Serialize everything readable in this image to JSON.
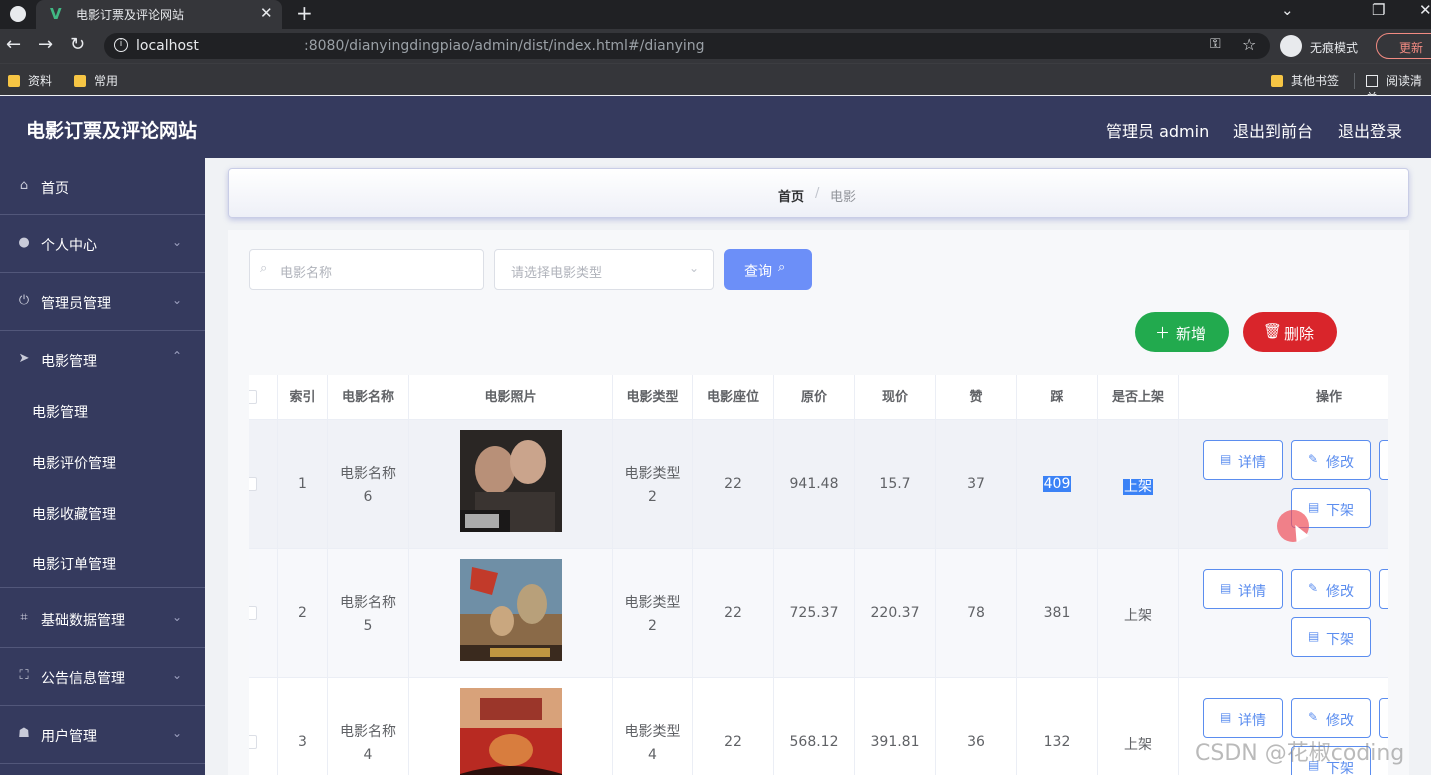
{
  "browser": {
    "tab_title": "电影订票及评论网站",
    "url_host": "localhost",
    "url_path": ":8080/dianyingdingpiao/admin/dist/index.html#/dianying",
    "incognito_label": "无痕模式",
    "update_label": "更新",
    "bookmarks": [
      "资料",
      "常用"
    ],
    "other_bookmarks": "其他书签",
    "reading_list": "阅读清单"
  },
  "header": {
    "title": "电影订票及评论网站",
    "admin_label": "管理员 admin",
    "front_label": "退出到前台",
    "logout_label": "退出登录"
  },
  "sidebar": {
    "items": [
      {
        "label": "首页",
        "icon": "home-icon"
      },
      {
        "label": "个人中心",
        "icon": "user-icon"
      },
      {
        "label": "管理员管理",
        "icon": "power-icon"
      },
      {
        "label": "电影管理",
        "icon": "send-icon"
      },
      {
        "label": "基础数据管理",
        "icon": "crop-icon"
      },
      {
        "label": "公告信息管理",
        "icon": "fullscreen-icon"
      },
      {
        "label": "用户管理",
        "icon": "thumb-icon"
      }
    ],
    "subitems": [
      "电影管理",
      "电影评价管理",
      "电影收藏管理",
      "电影订单管理"
    ]
  },
  "breadcrumb": {
    "home": "首页",
    "separator": "/",
    "current": "电影"
  },
  "search": {
    "name_placeholder": "电影名称",
    "type_placeholder": "请选择电影类型",
    "query_label": "查询",
    "add_label": "新增",
    "delete_label": "删除"
  },
  "table": {
    "columns": [
      "索引",
      "电影名称",
      "电影照片",
      "电影类型",
      "电影座位",
      "原价",
      "现价",
      "赞",
      "踩",
      "是否上架",
      "操作"
    ],
    "rows": [
      {
        "index": "1",
        "name_line1": "电影名称",
        "name_line2": "6",
        "type_line1": "电影类型",
        "type_line2": "2",
        "seats": "22",
        "original_price": "941.48",
        "current_price": "15.7",
        "likes": "37",
        "dislikes": "409",
        "on_shelf": "上架"
      },
      {
        "index": "2",
        "name_line1": "电影名称",
        "name_line2": "5",
        "type_line1": "电影类型",
        "type_line2": "2",
        "seats": "22",
        "original_price": "725.37",
        "current_price": "220.37",
        "likes": "78",
        "dislikes": "381",
        "on_shelf": "上架"
      },
      {
        "index": "3",
        "name_line1": "电影名称",
        "name_line2": "4",
        "type_line1": "电影类型",
        "type_line2": "4",
        "seats": "22",
        "original_price": "568.12",
        "current_price": "391.81",
        "likes": "36",
        "dislikes": "132",
        "on_shelf": "上架"
      }
    ],
    "actions": {
      "detail": "详情",
      "edit": "修改",
      "offshelf": "下架"
    }
  },
  "watermark": "CSDN @花椒coding",
  "colors": {
    "header_bg": "#353a5e",
    "primary": "#6c8ff8",
    "add_green": "#22aa4e",
    "delete_red": "#d9252b",
    "selection_blue": "#3b82f6"
  }
}
